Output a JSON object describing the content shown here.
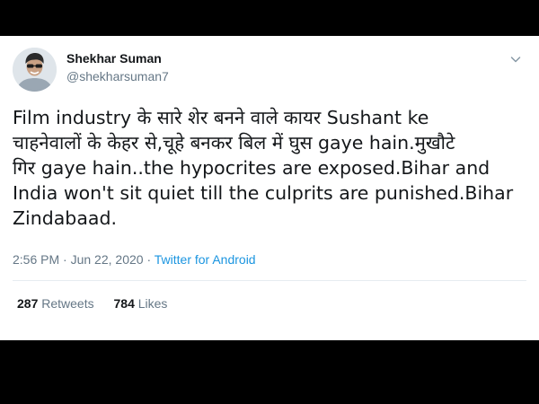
{
  "tweet": {
    "author_name": "Shekhar Suman",
    "author_handle": "@shekharsuman7",
    "text_lines": [
      "Film industry के सारे शेर बनने वाले कायर Sushant ke",
      "चाहनेवालों के केहर से,चूहे बनकर बिल में घुस gaye hain.मुखौटे",
      "गिर gaye hain..the hypocrites are exposed.Bihar and",
      "India won't sit quiet till the culprits are punished.Bihar",
      "Zindabaad."
    ],
    "time": "2:56 PM",
    "date": "Jun 22, 2020",
    "separator": "·",
    "source": "Twitter for Android",
    "retweets_count": "287",
    "retweets_label": "Retweets",
    "likes_count": "784",
    "likes_label": "Likes"
  },
  "icons": {
    "menu": "chevron-down-icon",
    "avatar": "profile-photo"
  },
  "colors": {
    "background": "#000000",
    "card": "#ffffff",
    "text": "#14171a",
    "secondary": "#657786",
    "link": "#1b95e0",
    "divider": "#e6ecf0"
  }
}
